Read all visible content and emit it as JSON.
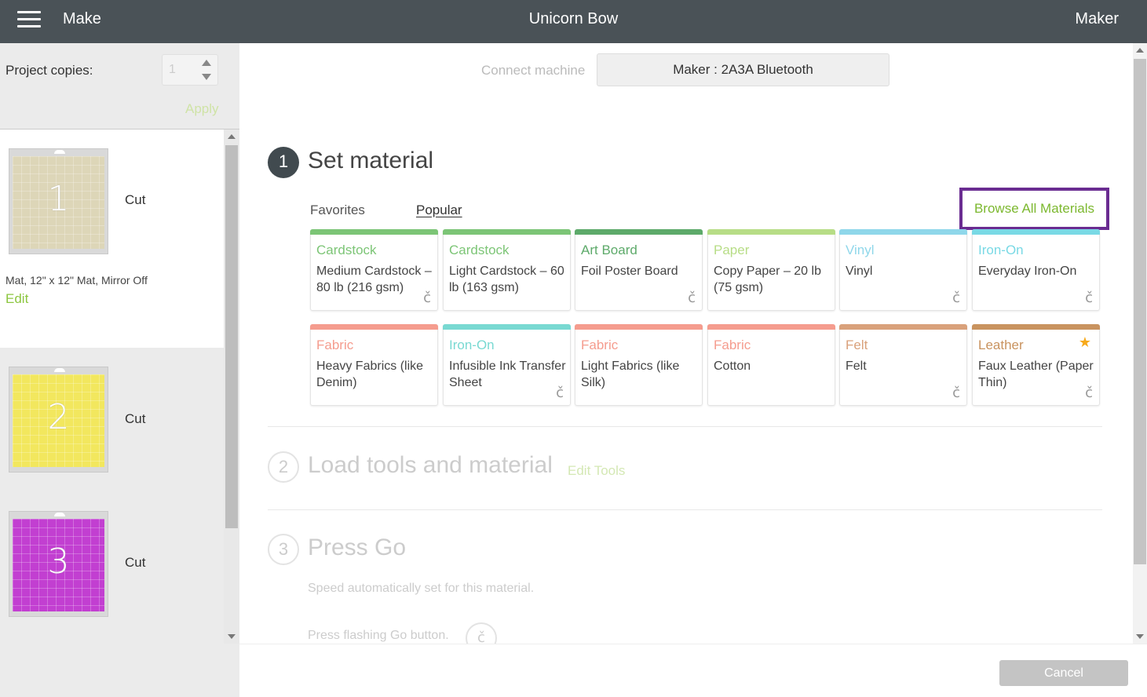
{
  "header": {
    "menu_icon": "hamburger-icon",
    "make_label": "Make",
    "project_title": "Unicorn Bow",
    "machine_label": "Maker"
  },
  "sidebar": {
    "copies_label": "Project copies:",
    "copies_value": "1",
    "apply_label": "Apply",
    "mats": [
      {
        "number": "1",
        "action": "Cut",
        "color": "#ddd6b8",
        "info": "Mat, 12\" x 12\" Mat, Mirror Off",
        "edit_label": "Edit"
      },
      {
        "number": "2",
        "action": "Cut",
        "color": "#f2e75e"
      },
      {
        "number": "3",
        "action": "Cut",
        "color": "#c23fd1"
      }
    ]
  },
  "main": {
    "connect_label": "Connect machine",
    "connect_button": "Maker : 2A3A Bluetooth",
    "step1": {
      "number": "1",
      "title": "Set material",
      "tabs": {
        "favorites": "Favorites",
        "popular": "Popular"
      },
      "browse_label": "Browse All Materials",
      "materials": [
        {
          "category": "Cardstock",
          "name": "Medium Cardstock – 80 lb (216 gsm)",
          "color": "#7cc576",
          "cricut": true
        },
        {
          "category": "Cardstock",
          "name": "Light Cardstock – 60 lb (163 gsm)",
          "color": "#7cc576",
          "cricut": false
        },
        {
          "category": "Art Board",
          "name": "Foil Poster Board",
          "color": "#5daa6a",
          "cricut": true
        },
        {
          "category": "Paper",
          "name": "Copy Paper – 20 lb (75 gsm)",
          "color": "#b7dd86",
          "cricut": false
        },
        {
          "category": "Vinyl",
          "name": "Vinyl",
          "color": "#8fd7ea",
          "cricut": true
        },
        {
          "category": "Iron-On",
          "name": "Everyday Iron-On",
          "color": "#79d9e5",
          "cricut": true
        },
        {
          "category": "Fabric",
          "name": "Heavy Fabrics (like Denim)",
          "color": "#f59c8e",
          "cricut": false
        },
        {
          "category": "Iron-On",
          "name": "Infusible Ink Transfer Sheet",
          "color": "#79d9d2",
          "cricut": true
        },
        {
          "category": "Fabric",
          "name": "Light Fabrics (like Silk)",
          "color": "#f59c8e",
          "cricut": false
        },
        {
          "category": "Fabric",
          "name": "Cotton",
          "color": "#f59c8e",
          "cricut": false
        },
        {
          "category": "Felt",
          "name": "Felt",
          "color": "#d9a17b",
          "cricut": true
        },
        {
          "category": "Leather",
          "name": "Faux Leather (Paper Thin)",
          "color": "#c9935f",
          "cricut": true,
          "favorite": true
        }
      ]
    },
    "step2": {
      "number": "2",
      "title": "Load tools and material",
      "edit_tools_label": "Edit Tools"
    },
    "step3": {
      "number": "3",
      "title": "Press Go",
      "speed_text": "Speed automatically set for this material.",
      "press_text": "Press flashing Go button."
    }
  },
  "footer": {
    "cancel_label": "Cancel"
  },
  "colors": {
    "topbar": "#4a5257",
    "accent_green": "#8cc63f",
    "highlight_purple": "#6a2c91"
  }
}
